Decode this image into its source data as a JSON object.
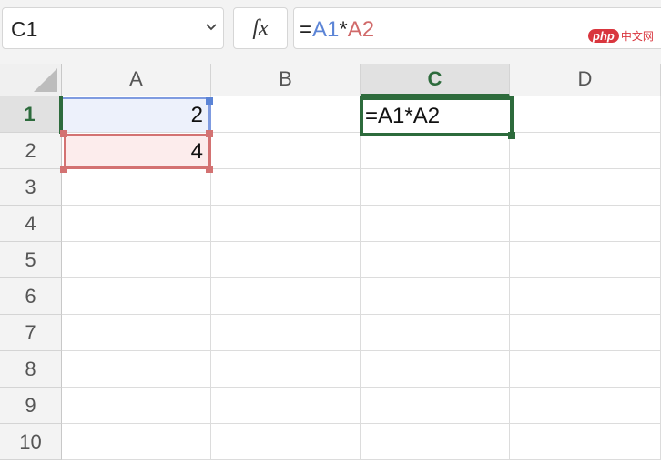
{
  "toolbar": {
    "name_box": "C1",
    "fx_label": "fx",
    "formula_prefix": "=",
    "formula_ref1": "A1",
    "formula_op": "*",
    "formula_ref2": "A2",
    "ref1_color": "#5b84d6",
    "ref2_color": "#d16a6a"
  },
  "watermark": {
    "pill": "php",
    "text": "中文网"
  },
  "columns": [
    "A",
    "B",
    "C",
    "D"
  ],
  "selected_column": "C",
  "rows": [
    "1",
    "2",
    "3",
    "4",
    "5",
    "6",
    "7",
    "8",
    "9",
    "10"
  ],
  "selected_row": "1",
  "cells": {
    "A1": "2",
    "A2": "4",
    "C1": "=A1*A2"
  },
  "accent_color": "#2d6b3c"
}
